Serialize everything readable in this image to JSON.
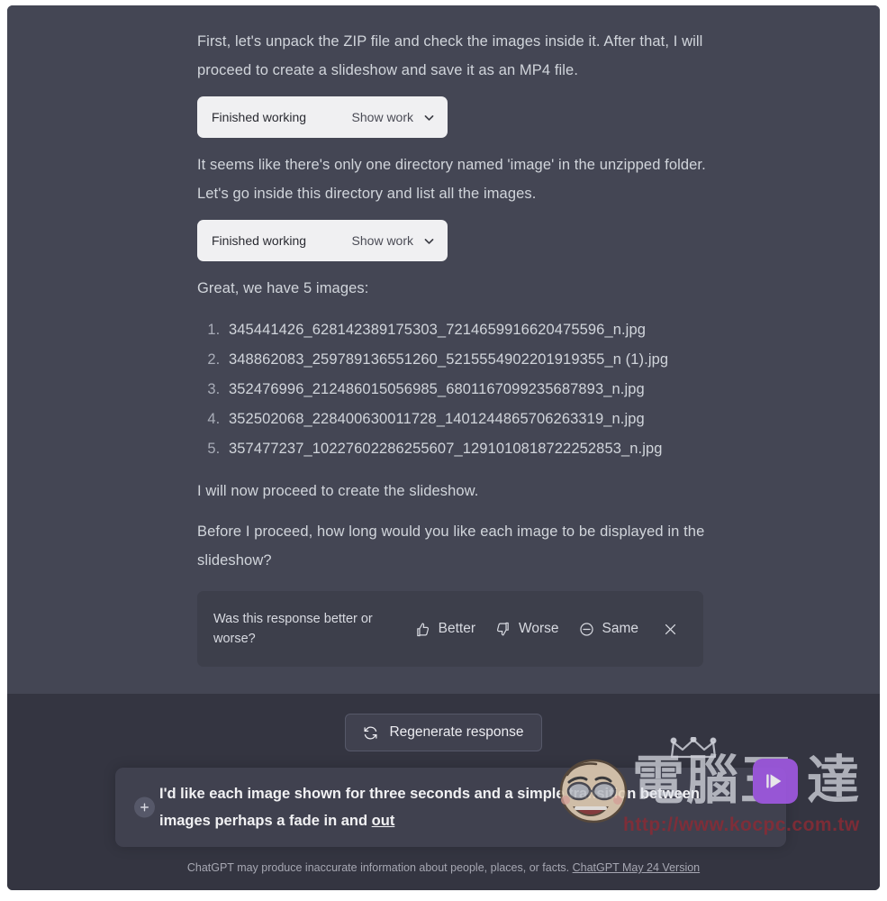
{
  "conversation": {
    "paragraphs": {
      "p1": "First, let's unpack the ZIP file and check the images inside it. After that, I will proceed to create a slideshow and save it as an MP4 file.",
      "p2": "It seems like there's only one directory named 'image' in the unzipped folder. Let's go inside this directory and list all the images.",
      "p3": "Great, we have 5 images:",
      "p4": "I will now proceed to create the slideshow.",
      "p5": "Before I proceed, how long would you like each image to be displayed in the slideshow?"
    },
    "tool_pill_1": {
      "status": "Finished working",
      "action": "Show work",
      "chevron": "chevron-down-icon"
    },
    "tool_pill_2": {
      "status": "Finished working",
      "action": "Show work",
      "chevron": "chevron-down-icon"
    },
    "files": [
      "345441426_628142389175303_7214659916620475596_n.jpg",
      "348862083_259789136551260_5215554902201919355_n (1).jpg",
      "352476996_212486015056985_6801167099235687893_n.jpg",
      "352502068_228400630011728_1401244865706263319_n.jpg",
      "357477237_10227602286255607_1291010818722252853_n.jpg"
    ],
    "feedback": {
      "question": "Was this response better or worse?",
      "better_label": "Better",
      "better_icon": "thumbs-up-icon",
      "worse_label": "Worse",
      "worse_icon": "thumbs-down-icon",
      "same_label": "Same",
      "same_icon": "minus-circle-icon",
      "close_icon": "close-icon"
    }
  },
  "bottom": {
    "regenerate": {
      "label": "Regenerate response",
      "icon": "refresh-icon"
    },
    "composer": {
      "attach_icon": "plus-icon",
      "text_part1": "I'd like each image shown for three seconds and a simple transition between images perhaps a fade in and ",
      "text_part2": "out"
    },
    "footnote": {
      "text": "ChatGPT may produce inaccurate information about people, places, or facts. ",
      "link": "ChatGPT May 24 Version"
    }
  },
  "watermark": {
    "cjk_left": "電腦王",
    "cjk_right": "達",
    "url": "http://www.kocpc.com.tw",
    "crown_icon": "crown-icon",
    "badge_icon": "play-badge-icon",
    "face_icon": "mascot-face-icon"
  },
  "colors": {
    "conversation_bg": "#444654",
    "composer_bg": "#40414f",
    "bottom_bg": "#343541",
    "pill_bg": "#f0f0f2",
    "text": "#d1d5db",
    "watermark_purple": "#a45ae8",
    "watermark_red": "#8e2b35"
  }
}
